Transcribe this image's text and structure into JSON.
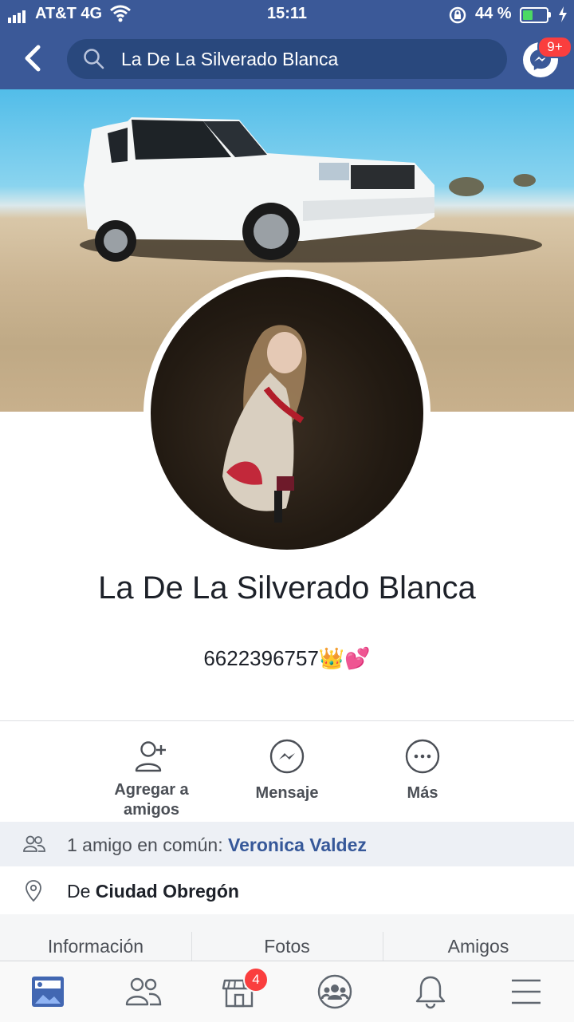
{
  "status_bar": {
    "carrier": "AT&T 4G",
    "time": "15:11",
    "battery_percent": "44 %",
    "battery_level": 0.44
  },
  "nav_bar": {
    "search_text": "La De La Silverado Blanca",
    "messenger_badge": "9+"
  },
  "profile": {
    "name": "La De La Silverado Blanca",
    "bio": "6622396757👑💕"
  },
  "actions": [
    {
      "label": "Agregar a",
      "label2": "amigos",
      "icon": "add-friend-icon"
    },
    {
      "label": "Mensaje",
      "icon": "messenger-icon"
    },
    {
      "label": "Más",
      "icon": "more-icon"
    }
  ],
  "mutual": {
    "prefix": "1 amigo en común: ",
    "name": "Veronica Valdez"
  },
  "location": {
    "prefix": "De ",
    "city": "Ciudad Obregón"
  },
  "profile_tabs": [
    "Información",
    "Fotos",
    "Amigos"
  ],
  "bottom_nav": {
    "items": [
      "news-feed-icon",
      "friends-icon",
      "marketplace-icon",
      "groups-icon",
      "notifications-icon",
      "menu-icon"
    ],
    "marketplace_badge": "4"
  },
  "colors": {
    "brand": "#3b5998",
    "badge": "#fa3e3e",
    "link": "#365899",
    "active": "#4267b2"
  }
}
